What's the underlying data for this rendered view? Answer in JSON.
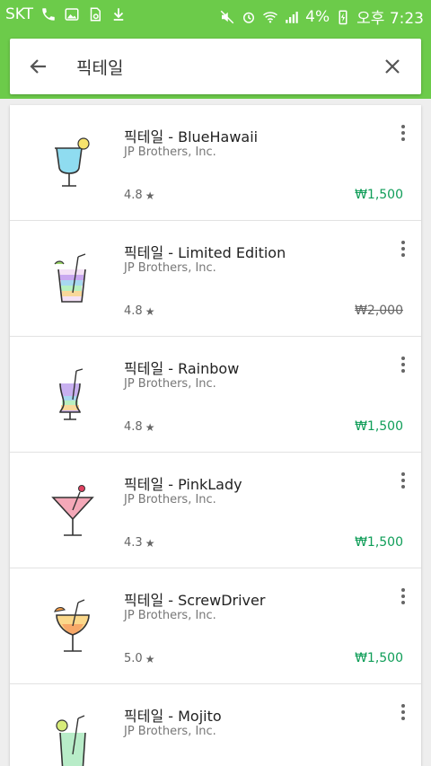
{
  "status_bar": {
    "carrier": "SKT",
    "battery": "4%",
    "clock": "오후 7:23"
  },
  "search": {
    "query": "픽테일"
  },
  "results": [
    {
      "title": "픽테일 - BlueHawaii",
      "developer": "JP Brothers, Inc.",
      "rating": "4.8",
      "price": "₩1,500",
      "strikethrough": false,
      "icon": "blue-hawaii-cocktail-icon"
    },
    {
      "title": "픽테일 - Limited Edition",
      "developer": "JP Brothers, Inc.",
      "rating": "4.8",
      "price": "₩2,000",
      "strikethrough": true,
      "icon": "rainbow-glass-cocktail-icon"
    },
    {
      "title": "픽테일 - Rainbow",
      "developer": "JP Brothers, Inc.",
      "rating": "4.8",
      "price": "₩1,500",
      "strikethrough": false,
      "icon": "rainbow-cocktail-icon"
    },
    {
      "title": "픽테일 - PinkLady",
      "developer": "JP Brothers, Inc.",
      "rating": "4.3",
      "price": "₩1,500",
      "strikethrough": false,
      "icon": "pink-lady-cocktail-icon"
    },
    {
      "title": "픽테일 - ScrewDriver",
      "developer": "JP Brothers, Inc.",
      "rating": "5.0",
      "price": "₩1,500",
      "strikethrough": false,
      "icon": "screwdriver-cocktail-icon"
    },
    {
      "title": "픽테일 - Mojito",
      "developer": "JP Brothers, Inc.",
      "rating": "",
      "price": "",
      "strikethrough": false,
      "icon": "mojito-cocktail-icon"
    }
  ],
  "colors": {
    "status_bar": "#6ccb4a",
    "price": "#0f9d58"
  }
}
